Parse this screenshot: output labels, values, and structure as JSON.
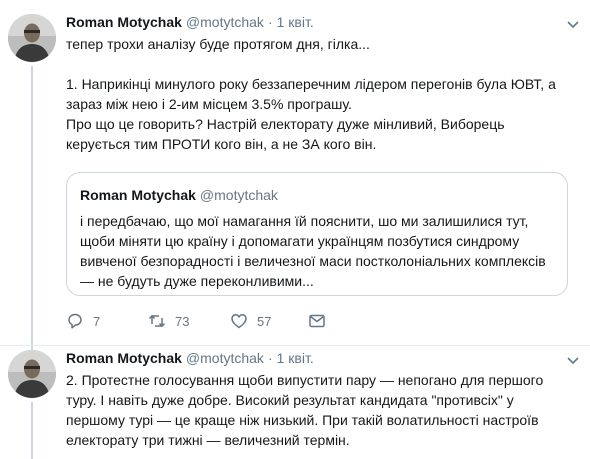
{
  "tweet1": {
    "author_name": "Roman Motychak",
    "author_handle": "@motytchak",
    "separator": "·",
    "time": "1 квіт.",
    "lines": [
      "тепер трохи аналізу буде протягом дня, гілка...",
      "",
      "1. Наприкінці минулого року беззаперечним лідером перегонів була ЮВТ, а",
      "зараз між нею і 2-им місцем 3.5% програшу.",
      "Про що це говорить? Настрій електорату дуже мінливий, Виборець",
      "керується тим ПРОТИ кого він, а не ЗА кого він."
    ],
    "quote": {
      "author_name": "Roman Motychak",
      "author_handle": "@motytchak",
      "lines": [
        "і передбачаю, що мої намагання їй пояснити, шо ми залишилися тут,",
        "щоби міняти цю країну і допомагати українцям позбутися синдрому",
        "вивченої безпорадності і величезної маси постколоніальних комплексів",
        "— не будуть дуже переконливими..."
      ]
    },
    "actions": {
      "reply_count": "7",
      "retweet_count": "73",
      "like_count": "57"
    }
  },
  "tweet2": {
    "author_name": "Roman Motychak",
    "author_handle": "@motytchak",
    "separator": "·",
    "time": "1 квіт.",
    "lines": [
      "2. Протестне голосування щоби випустити пару — непогано для першого",
      "туру. І навіть дуже добре. Високий результат кандидата \"противсіх\" у",
      "першому турі — це краще ніж низький. При такій волатильності настроїв",
      "електорату три тижні — величезний термін."
    ]
  },
  "colors": {
    "text": "#14171a",
    "secondary": "#657786",
    "border": "#e6ecf0",
    "thread_line": "#ccd6dd"
  }
}
